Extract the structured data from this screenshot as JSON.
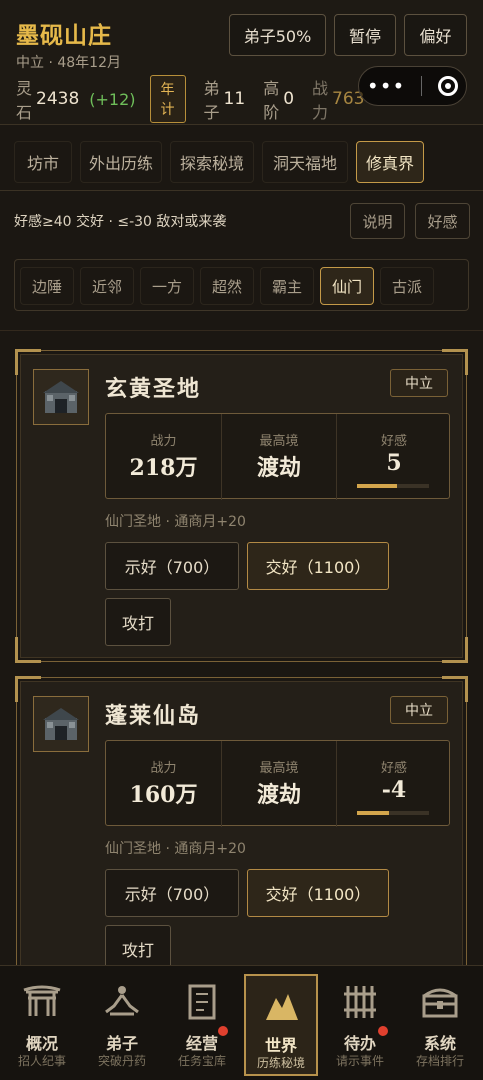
{
  "header": {
    "title": "墨砚山庄",
    "subtitle": "中立 · 48年12月",
    "buttons": [
      "弟子50%",
      "暂停",
      "偏好"
    ],
    "stats": {
      "spirit_stone_label": "灵石",
      "spirit_stone_value": "2438",
      "spirit_stone_delta": "(+12)",
      "annual_label": "年计",
      "disciples_label": "弟子",
      "disciples_value": "11",
      "high_label": "高阶",
      "high_value": "0",
      "power_label": "战力",
      "power_value": "763"
    }
  },
  "tabs": [
    "坊市",
    "外出历练",
    "探索秘境",
    "洞天福地",
    "修真界"
  ],
  "active_tab": "修真界",
  "filter": {
    "text": "好感≥40 交好 · ≤-30 敌对或来袭",
    "buttons": [
      "说明",
      "好感"
    ]
  },
  "subtabs": [
    "边陲",
    "近邻",
    "一方",
    "超然",
    "霸主",
    "仙门",
    "古派"
  ],
  "active_subtab": "仙门",
  "factions": [
    {
      "name": "玄黄圣地",
      "stance": "中立",
      "power_label": "战力",
      "power": "218万",
      "realm_label": "最高境",
      "realm": "渡劫",
      "favor_label": "好感",
      "favor": "5",
      "favor_fill": 0.55,
      "desc": "仙门圣地 · 通商月+20",
      "actions": [
        "示好（700）",
        "交好（1100）",
        "攻打"
      ]
    },
    {
      "name": "蓬莱仙岛",
      "stance": "中立",
      "power_label": "战力",
      "power": "160万",
      "realm_label": "最高境",
      "realm": "渡劫",
      "favor_label": "好感",
      "favor": "-4",
      "favor_fill": 0.45,
      "desc": "仙门圣地 · 通商月+20",
      "actions": [
        "示好（700）",
        "交好（1100）",
        "攻打"
      ]
    }
  ],
  "bottom_nav": [
    {
      "label": "概况",
      "sub": "招人纪事",
      "icon": "gate-icon"
    },
    {
      "label": "弟子",
      "sub": "突破丹药",
      "icon": "meditation-icon"
    },
    {
      "label": "经营",
      "sub": "任务宝库",
      "icon": "scroll-icon",
      "badge": true
    },
    {
      "label": "世界",
      "sub": "历练秘境",
      "icon": "mountain-icon",
      "active": true
    },
    {
      "label": "待办",
      "sub": "请示事件",
      "icon": "bamboo-icon",
      "badge": true
    },
    {
      "label": "系统",
      "sub": "存档排行",
      "icon": "chest-icon"
    }
  ]
}
